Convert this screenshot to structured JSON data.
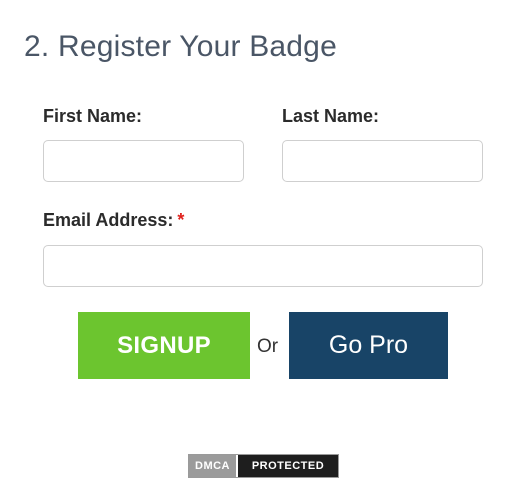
{
  "section": {
    "title": "2. Register Your Badge"
  },
  "form": {
    "first_name": {
      "label": "First Name:",
      "value": "",
      "placeholder": ""
    },
    "last_name": {
      "label": "Last Name:",
      "value": "",
      "placeholder": ""
    },
    "email": {
      "label": "Email Address:",
      "required_marker": "*",
      "value": "",
      "placeholder": ""
    }
  },
  "actions": {
    "signup_label": "SIGNUP",
    "or_text": "Or",
    "go_pro_label": "Go Pro"
  },
  "badge": {
    "left_text": "DMCA",
    "right_text": "PROTECTED"
  },
  "colors": {
    "signup_bg": "#6cc52f",
    "go_pro_bg": "#184467",
    "required": "#e0201b"
  }
}
